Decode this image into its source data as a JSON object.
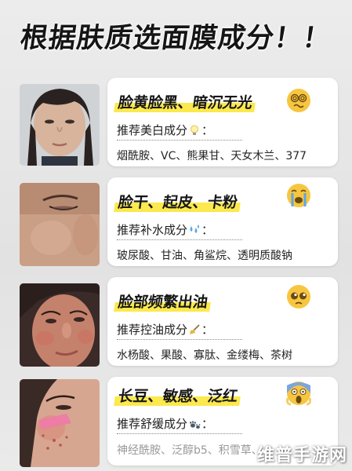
{
  "headline": "根据肤质选面膜成分！！",
  "rows": [
    {
      "title": "脸黄脸黑、暗沉无光",
      "emoji": "dizzy-face-emoji",
      "rec_label": "推荐美白成分",
      "rec_icon": "lightbulb-icon",
      "rec_suffix": "：",
      "ingredients": "烟酰胺、VC、熊果甘、天女木兰、377"
    },
    {
      "title": "脸干、起皮、卡粉",
      "emoji": "crying-face-emoji",
      "rec_label": "推荐补水成分",
      "rec_icon": "water-droplets-icon",
      "rec_suffix": "：",
      "ingredients": "玻尿酸、甘油、角鲨烷、透明质酸钠"
    },
    {
      "title": "脸部频繁出油",
      "emoji": "pleading-face-emoji",
      "rec_label": "推荐控油成分",
      "rec_icon": "broom-icon",
      "rec_suffix": "：",
      "ingredients": "水杨酸、果酸、寡肽、金缕梅、茶树"
    },
    {
      "title": "长豆、敏感、泛红",
      "emoji": "screaming-face-emoji",
      "rec_label": "推荐舒缓成分",
      "rec_icon": "paw-prints-icon",
      "rec_suffix": "：",
      "ingredients": "神经酰胺、泛醇b5、积雪草、"
    }
  ],
  "watermark": "维普手游网",
  "colors": {
    "highlight": "#fbe94d",
    "card": "#ffffff",
    "background": "#e6e6e6"
  }
}
